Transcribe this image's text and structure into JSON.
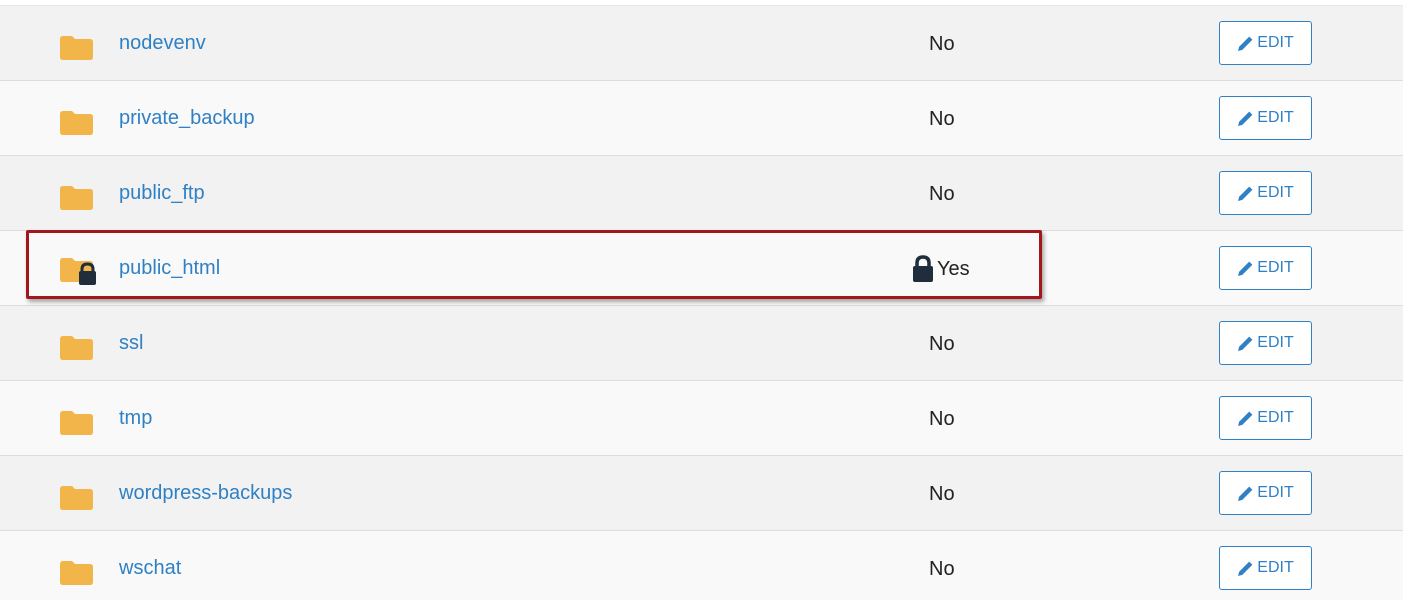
{
  "columns": {
    "edit_label": "EDIT"
  },
  "colors": {
    "link": "#2f80c4",
    "folder": "#f2b54a",
    "lock": "#1f2d3d",
    "highlight": "#a3161b"
  },
  "rows": [
    {
      "name": "nodevenv",
      "protected": "No",
      "locked": false,
      "icon": "folder-icon"
    },
    {
      "name": "private_backup",
      "protected": "No",
      "locked": false,
      "icon": "folder-icon"
    },
    {
      "name": "public_ftp",
      "protected": "No",
      "locked": false,
      "icon": "folder-icon"
    },
    {
      "name": "public_html",
      "protected": "Yes",
      "locked": true,
      "icon": "locked-folder-icon"
    },
    {
      "name": "ssl",
      "protected": "No",
      "locked": false,
      "icon": "folder-icon"
    },
    {
      "name": "tmp",
      "protected": "No",
      "locked": false,
      "icon": "folder-icon"
    },
    {
      "name": "wordpress-backups",
      "protected": "No",
      "locked": false,
      "icon": "folder-icon"
    },
    {
      "name": "wschat",
      "protected": "No",
      "locked": false,
      "icon": "folder-icon"
    }
  ]
}
